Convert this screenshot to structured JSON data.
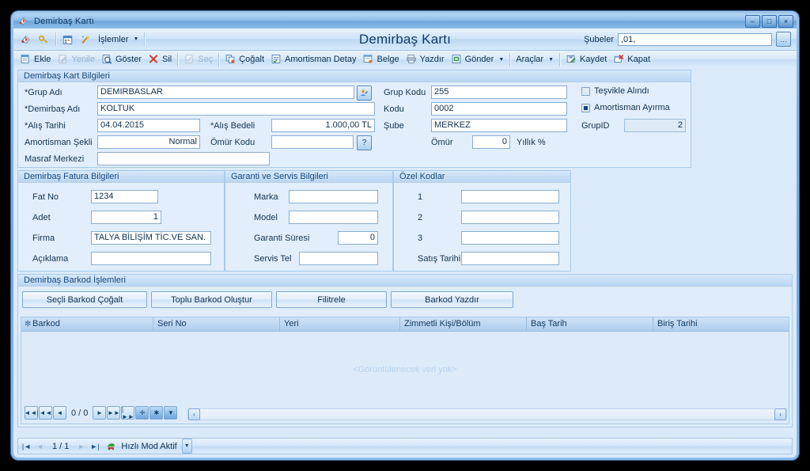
{
  "window": {
    "title": "Demirbaş Kartı",
    "icon": "app-icon",
    "minimize": "–",
    "maximize": "□",
    "close": "×"
  },
  "header": {
    "big_title": "Demirbaş Kartı",
    "branch_label": "Şubeler",
    "branch_value": ",01,",
    "branch_picker": "…"
  },
  "cmdbar_top": {
    "items": [
      {
        "name": "cmd-new-record",
        "icon": "card-icon",
        "label": "",
        "disabled": false
      },
      {
        "name": "cmd-key",
        "icon": "key-icon",
        "label": "",
        "disabled": false
      },
      {
        "name": "cmd-calendar",
        "icon": "calendar-icon",
        "label": "",
        "disabled": false
      },
      {
        "name": "cmd-wizard",
        "icon": "wand-icon",
        "label": "",
        "disabled": false
      }
    ],
    "menu": {
      "label": "İşlemler",
      "caret": "▼"
    }
  },
  "toolbar": {
    "items": [
      {
        "name": "ekle",
        "label": "Ekle",
        "icon": "add-icon",
        "disabled": false
      },
      {
        "name": "yenile",
        "label": "Yenile",
        "icon": "edit-icon",
        "disabled": true
      },
      {
        "name": "goster",
        "label": "Göster",
        "icon": "view-icon",
        "disabled": false
      },
      {
        "name": "sil",
        "label": "Sil",
        "icon": "delete-icon",
        "disabled": false
      },
      {
        "name": "sec",
        "label": "Seç",
        "icon": "select-icon",
        "disabled": true
      },
      {
        "name": "cogalt",
        "label": "Çoğalt",
        "icon": "copy-icon",
        "disabled": false
      },
      {
        "name": "amortisman-detay",
        "label": "Amortisman Detay",
        "icon": "list-icon",
        "disabled": false
      },
      {
        "name": "belge",
        "label": "Belge",
        "icon": "document-icon",
        "disabled": false
      },
      {
        "name": "yazdir",
        "label": "Yazdır",
        "icon": "print-icon",
        "disabled": false
      },
      {
        "name": "gonder",
        "label": "Gönder",
        "icon": "excel-icon",
        "disabled": false,
        "caret": "▼"
      },
      {
        "name": "araclar",
        "label": "Araçlar",
        "icon": "",
        "disabled": false,
        "caret": "▼"
      },
      {
        "name": "kaydet",
        "label": "Kaydet",
        "icon": "save-icon",
        "disabled": false
      },
      {
        "name": "kapat",
        "label": "Kapat",
        "icon": "close-doc-icon",
        "disabled": false
      }
    ]
  },
  "card_panel": {
    "title": "Demirbaş Kart Bilgileri",
    "fields": {
      "grup_adi_label": "*Grup Adı",
      "grup_adi_value": "DEMIRBASLAR",
      "grup_adi_picker": "picker-icon",
      "demirbas_adi_label": "*Demirbaş Adı",
      "demirbas_adi_value": "KOLTUK",
      "alis_tarihi_label": "*Alış Tarihi",
      "alis_tarihi_value": "04.04.2015",
      "alis_bedeli_label": "*Alış Bedeli",
      "alis_bedeli_value": "1.000,00 TL",
      "amortisman_sekli_label": "Amortisman Şekli",
      "amortisman_sekli_value": "Normal",
      "omur_kodu_label": "Ömür Kodu",
      "omur_kodu_value": "",
      "omur_kodu_help": "?",
      "masraf_merkezi_label": "Masraf Merkezi",
      "masraf_merkezi_value": "",
      "grup_kodu_label": "Grup Kodu",
      "grup_kodu_value": "255",
      "kodu_label": "Kodu",
      "kodu_value": "0002",
      "sube_label": "Şube",
      "sube_value": "MERKEZ",
      "omur_label": "Ömür",
      "omur_value": "0",
      "yillik_label": "Yıllık %",
      "tesvikle_alindi_label": "Teşvikle Alındı",
      "tesvikle_alindi_checked": false,
      "amortisman_ayirma_label": "Amortisman Ayırma",
      "amortisman_ayirma_checked": true,
      "grupid_label": "GrupID",
      "grupid_value": "2"
    }
  },
  "invoice_panel": {
    "title": "Demirbaş Fatura Bilgileri",
    "fields": {
      "fat_no_label": "Fat No",
      "fat_no_value": "1234",
      "adet_label": "Adet",
      "adet_value": "1",
      "firma_label": "Firma",
      "firma_value": "TALYA BİLİŞİM TİC.VE SAN.",
      "aciklama_label": "Açıklama",
      "aciklama_value": ""
    }
  },
  "warranty_panel": {
    "title": "Garanti ve Servis Bilgileri",
    "fields": {
      "marka_label": "Marka",
      "marka_value": "",
      "model_label": "Model",
      "model_value": "",
      "garanti_suresi_label": "Garanti Süresi",
      "garanti_suresi_value": "0",
      "servis_tel_label": "Servis Tel",
      "servis_tel_value": ""
    }
  },
  "special_codes_panel": {
    "title": "Özel Kodlar",
    "fields": {
      "kod1_label": "1",
      "kod1_value": "",
      "kod2_label": "2",
      "kod2_value": "",
      "kod3_label": "3",
      "kod3_value": "",
      "satis_tarihi_label": "Satış Tarihi",
      "satis_tarihi_value": ""
    }
  },
  "barcode_panel": {
    "title": "Demirbaş Barkod İşlemleri",
    "buttons": [
      {
        "name": "secili-barkod-cogalt",
        "label": "Seçli Barkod Çoğalt"
      },
      {
        "name": "toplu-barkod-olustur",
        "label": "Toplu Barkod Oluştur"
      },
      {
        "name": "filtrele",
        "label": "Filitrele"
      },
      {
        "name": "barkod-yazdir",
        "label": "Barkod Yazdır"
      }
    ],
    "grid": {
      "columns": [
        {
          "name": "barkod",
          "label": "Barkod",
          "width": 167
        },
        {
          "name": "seri-no",
          "label": "Seri No",
          "width": 160
        },
        {
          "name": "yeri",
          "label": "Yeri",
          "width": 152
        },
        {
          "name": "zimmetli-kisi-bolum",
          "label": "Zimmetli Kişi/Bölüm",
          "width": 160
        },
        {
          "name": "bas-tarih",
          "label": "Baş Tarih",
          "width": 160
        },
        {
          "name": "biris-tarihi",
          "label": "Biriş Tarihi",
          "width": 160
        }
      ],
      "rows": [],
      "empty_text": "<Görüntülenecek veri yok>",
      "record_nav": {
        "first": "◄◄|",
        "prev_page": "◄◄",
        "prev": "◄",
        "counter": "0 / 0",
        "next": "►",
        "next_page": "►►",
        "last": "|►►",
        "add": "✛",
        "star": "✱",
        "filter": "▼"
      },
      "hscroll": {
        "left": "‹",
        "right": "›"
      }
    }
  },
  "footer": {
    "first": "|◄",
    "prev": "◄",
    "counter": "1 / 1",
    "next": "►",
    "last": "►|",
    "mode_icon": "speed-icon",
    "mode_label": "Hızlı Mod Aktif",
    "dropdown": "▼"
  },
  "colors": {
    "accent": "#12334f",
    "title_blue": "#123c6b",
    "panel_bg": "#e2eefb",
    "body_bg": "#dbeafa",
    "border": "#a9cbea",
    "empty_text": "#b9d3ef"
  }
}
